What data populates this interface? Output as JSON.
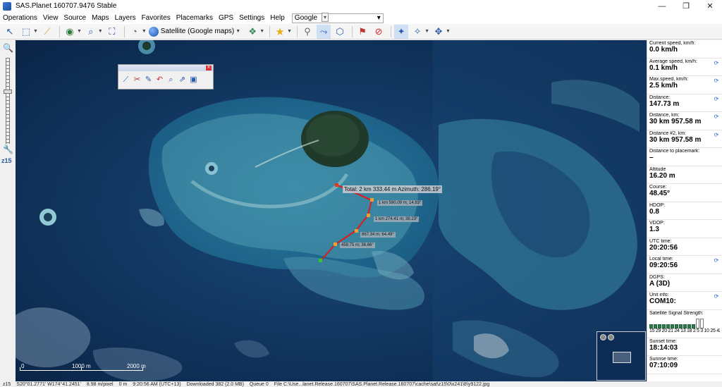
{
  "window": {
    "title": "SAS.Planet 160707.9476 Stable",
    "minimize": "—",
    "maximize": "❐",
    "close": "✕"
  },
  "menu": {
    "items": [
      "Operations",
      "View",
      "Source",
      "Maps",
      "Layers",
      "Favorites",
      "Placemarks",
      "GPS",
      "Settings",
      "Help"
    ],
    "search_provider": "Google"
  },
  "toolbar": {
    "map_source": "Satellite (Google maps)"
  },
  "zoom": {
    "level": "z15"
  },
  "measurement": {
    "total": "Total: 2 km 333.44 m Azimuth: 286.19°",
    "segments": [
      "1 km 590.09 m; 14.83°",
      "1 km 274.41 m; 38.23°",
      "867.34 m; 64.49°",
      "459.75 m; 36.66°"
    ]
  },
  "scale": {
    "zero": "0",
    "mid": "1000 m",
    "end": "2000 m"
  },
  "gps_panel": [
    {
      "label": "Current speed, km/h:",
      "value": "0.0 km/h",
      "refresh": false
    },
    {
      "label": "Average speed, km/h:",
      "value": "0.1 km/h",
      "refresh": true
    },
    {
      "label": "Max.speed, km/h:",
      "value": "2.5 km/h",
      "refresh": true
    },
    {
      "label": "Distance:",
      "value": "147.73 m",
      "refresh": true
    },
    {
      "label": "Distance, km:",
      "value": "30 km 957.58 m",
      "refresh": true
    },
    {
      "label": "Distance #2, km:",
      "value": "30 km 957.58 m",
      "refresh": true
    },
    {
      "label": "Distance to placemark:",
      "value": "–",
      "refresh": false
    },
    {
      "label": "Altitude",
      "value": "16.20 m",
      "refresh": false
    },
    {
      "label": "Course:",
      "value": "48.45°",
      "refresh": false
    },
    {
      "label": "HDOP:",
      "value": "0.8",
      "refresh": false
    },
    {
      "label": "VDOP:",
      "value": "1.3",
      "refresh": false
    },
    {
      "label": "UTC time:",
      "value": "20:20:56",
      "refresh": false
    },
    {
      "label": "Local time:",
      "value": "09:20:56",
      "refresh": true
    },
    {
      "label": "DGPS:",
      "value": "A (3D)",
      "refresh": false
    },
    {
      "label": "Unit info:",
      "value": "COM10:",
      "refresh": true
    }
  ],
  "satellites": {
    "label": "Satellite Signal Strength:",
    "numbers": "15 29 20 21 24 13 18  2  5  3 10 25 42",
    "levels": [
      0.35,
      0.35,
      0.35,
      0.35,
      0.35,
      0.35,
      0.35,
      0.35,
      0.35,
      0.35,
      0.35,
      0.0,
      0.0
    ]
  },
  "gps_panel_bottom": [
    {
      "label": "Sunset time:",
      "value": "18:14:03"
    },
    {
      "label": "Sunrise time:",
      "value": "07:10:09"
    }
  ],
  "statusbar": {
    "zoom": "z15",
    "coords": "S20°01.2771' W174°41.2451'",
    "resolution": "8.98 m/pixel",
    "dist": "0 m",
    "time": "9:20:56 AM (UTC+13)",
    "downloaded": "Downloaded 382 (2.0 MB)",
    "queue": "Queue 0",
    "file": "File C:\\Use...lanet.Release.160707\\SAS.Planet.Release.160707\\cache\\sat\\z15\\0\\x241\\8\\y9122.jpg"
  }
}
